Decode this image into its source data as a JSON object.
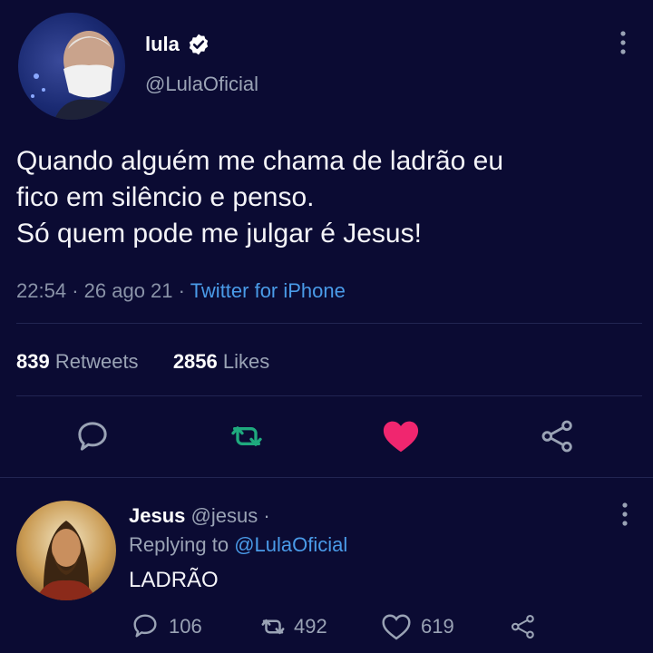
{
  "tweet": {
    "author_name": "lula",
    "author_handle": "@LulaOficial",
    "text_lines": [
      "Quando alguém me chama de ladrão eu",
      "fico em silêncio e penso.",
      "Só quem pode me julgar é Jesus!"
    ],
    "time": "22:54",
    "date": "26 ago 21",
    "source": "Twitter for iPhone",
    "retweets_count": "839",
    "retweets_label": "Retweets",
    "likes_count": "2856",
    "likes_label": "Likes"
  },
  "reply": {
    "author_name": "Jesus",
    "author_handle": "@jesus ·",
    "replying_prefix": "Replying to",
    "replying_to": "@LulaOficial",
    "text": "LADRÃO",
    "reply_count": "106",
    "retweet_count": "492",
    "like_count": "619"
  },
  "icons": {
    "verified": "verified-badge-icon",
    "more": "more-vertical-icon",
    "reply": "reply-bubble-icon",
    "retweet": "retweet-icon",
    "like": "heart-icon",
    "share": "share-icon"
  },
  "colors": {
    "background": "#0b0b33",
    "link": "#4a9be8",
    "retweet": "#1faa7e",
    "like": "#f0266f",
    "muted": "#9aa3b5"
  }
}
